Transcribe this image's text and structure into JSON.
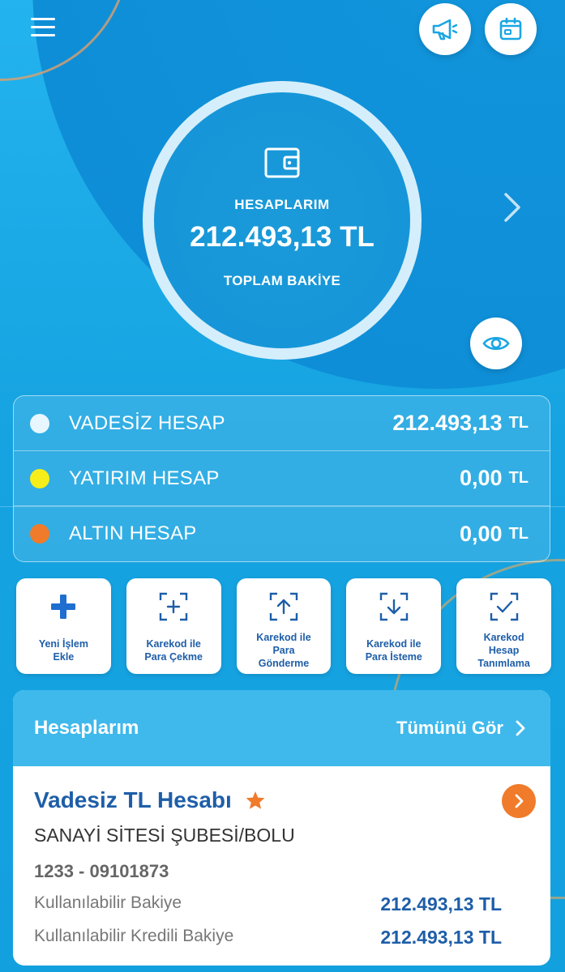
{
  "hero": {
    "title": "HESAPLARIM",
    "amount": "212.493,13 TL",
    "subtitle": "TOPLAM BAKİYE"
  },
  "top_buttons": {
    "announcements_icon": "megaphone-icon",
    "calendar_icon": "calendar-icon"
  },
  "accounts": [
    {
      "name": "VADESİZ HESAP",
      "value": "212.493,13",
      "currency": "TL",
      "dot_color": "#e8f6ff"
    },
    {
      "name": "YATIRIM HESAP",
      "value": "0,00",
      "currency": "TL",
      "dot_color": "#f5ee1b"
    },
    {
      "name": "ALTIN HESAP",
      "value": "0,00",
      "currency": "TL",
      "dot_color": "#f07b2a"
    }
  ],
  "actions": [
    {
      "label": "Yeni İşlem\nEkle",
      "icon": "plus-icon"
    },
    {
      "label": "Karekod ile\nPara Çekme",
      "icon": "qr-plus-icon"
    },
    {
      "label": "Karekod ile\nPara\nGönderme",
      "icon": "qr-upload-icon"
    },
    {
      "label": "Karekod ile\nPara İsteme",
      "icon": "qr-download-icon"
    },
    {
      "label": "Karekod\nHesap\nTanımlama",
      "icon": "qr-check-icon"
    }
  ],
  "accounts_section": {
    "title": "Hesaplarım",
    "see_all": "Tümünü Gör",
    "card": {
      "title": "Vadesiz TL Hesabı",
      "branch": "SANAYİ SİTESİ ŞUBESİ/BOLU",
      "account_no": "1233 - 09101873",
      "available_label": "Kullanılabilir Bakiye",
      "available_value": "212.493,13 TL",
      "credit_label": "Kullanılabilir Kredili Bakiye",
      "credit_value": "212.493,13 TL"
    }
  },
  "colors": {
    "background": "#1aa6e3",
    "primary_text": "#1e5ea8",
    "accent_orange": "#f07b2a",
    "header_blue": "#3fb9ec"
  }
}
